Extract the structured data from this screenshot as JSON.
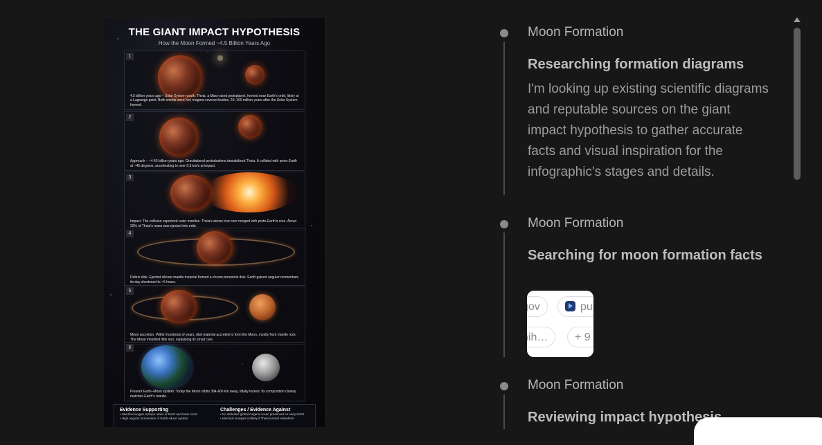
{
  "infographic": {
    "title": "THE GIANT IMPACT HYPOTHESIS",
    "subtitle": "How the Moon Formed ~4.5 Billion Years Ago",
    "stages": [
      {
        "num": "1",
        "text": "4.5 billion years ago – Solar System youth. Theia, a Mars-sized protoplanet, formed near Earth's orbit, likely at a Lagrange point. Both worlds were hot, magma-covered bodies, 20–100 million years after the Solar System formed."
      },
      {
        "num": "2",
        "text": "Approach – ~4.45 billion years ago. Gravitational perturbations destabilized Theia. It collided with proto-Earth at ~45 degrees, accelerating to over 9.3 km/s at impact."
      },
      {
        "num": "3",
        "text": "Impact. The collision vaporized outer mantles. Theia's dense iron core merged with proto-Earth's core. About 20% of Theia's mass was ejected into orbit."
      },
      {
        "num": "4",
        "text": "Debris disk. Ejected silicate mantle material formed a circum-terrestrial disk. Earth gained angular momentum; its day shortened to ~5 hours."
      },
      {
        "num": "5",
        "text": "Moon accretion. Within hundreds of years, disk material accreted to form the Moon, mostly from mantle rock. The Moon inherited little iron, explaining its small core."
      },
      {
        "num": "6",
        "text": "Present Earth–Moon system. Today the Moon orbits 384,400 km away, tidally locked. Its composition closely matches Earth's mantle."
      }
    ],
    "evidence": {
      "supporting_title": "Evidence Supporting",
      "supporting_items": [
        "• Identical oxygen isotope ratios in Earth and lunar rocks",
        "• High angular momentum of Earth–Moon system"
      ],
      "against_title": "Challenges / Evidence Against",
      "against_items": [
        "• No definitive global magma ocean preserved on early Earth",
        "• Identical isotopes unlikely if Theia formed elsewhere"
      ]
    }
  },
  "timeline": [
    {
      "category": "Moon Formation",
      "heading": "Researching formation diagrams",
      "description": "I'm looking up existing scientific diagrams and reputable sources on the giant impact hypothesis to gather accurate facts and visual inspiration for the infographic's stages and details."
    },
    {
      "category": "Moon Formation",
      "heading": "Searching for moon formation facts",
      "sources": {
        "chip_gov": "gov",
        "chip_pub": "pu",
        "chip_nih": "nih…",
        "chip_more": "+ 9"
      }
    },
    {
      "category": "Moon Formation",
      "heading": "Reviewing impact hypothesis"
    }
  ]
}
